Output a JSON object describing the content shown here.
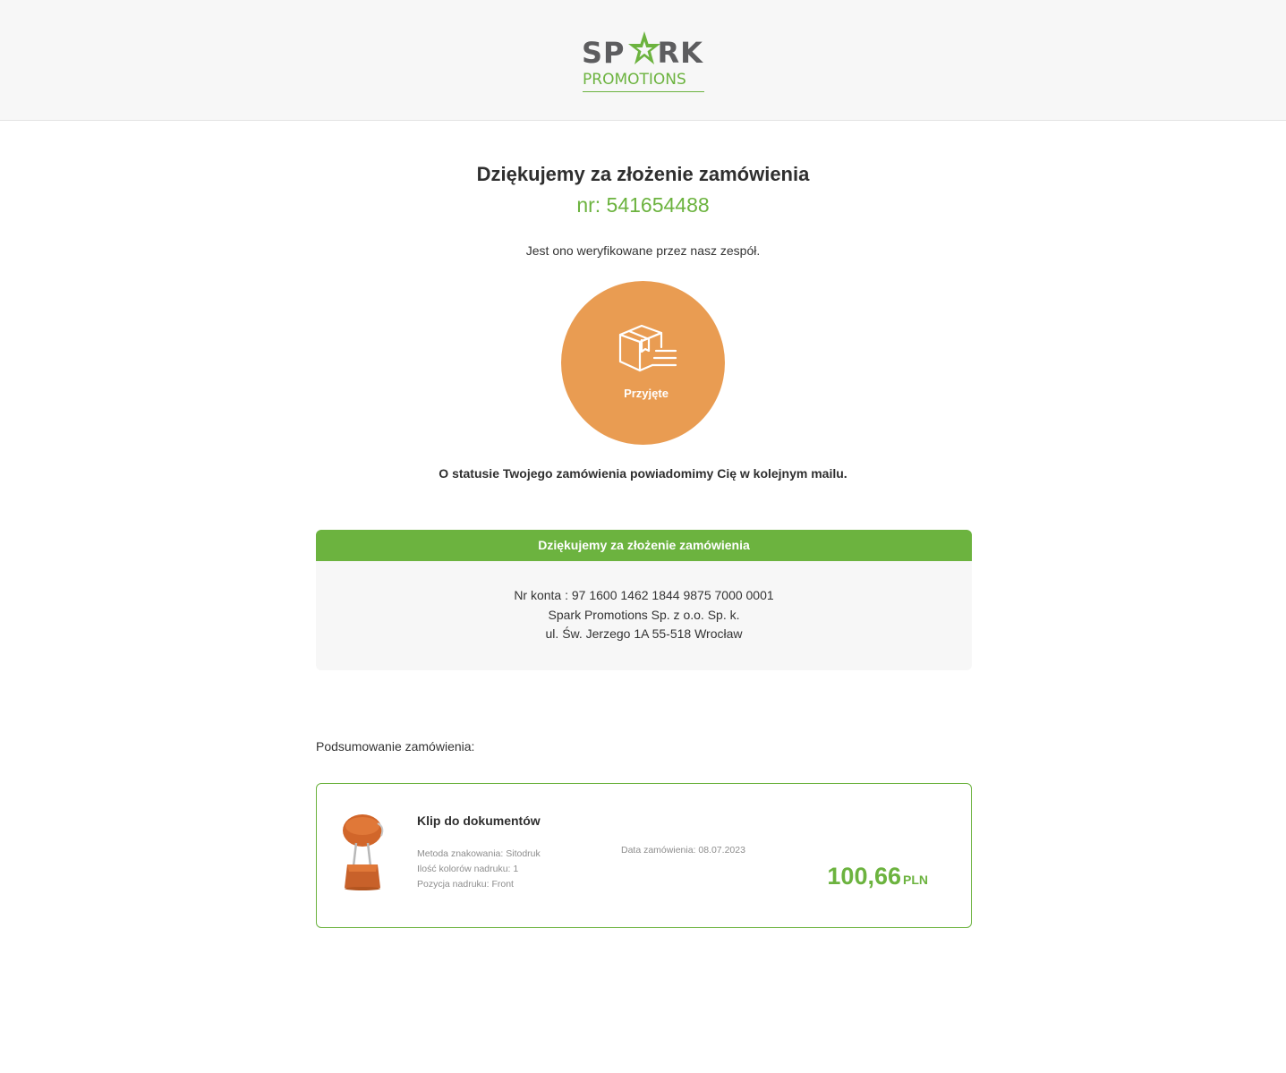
{
  "header": {
    "logo": {
      "top_left": "SP",
      "top_right": "RK",
      "bottom": "PROMOTIONS",
      "primary_color": "#5d5d5f",
      "accent_color": "#6cb33f"
    }
  },
  "confirmation": {
    "title": "Dziękujemy za złożenie zamówienia",
    "order_number": "nr: 541654488",
    "verification_text": "Jest ono weryfikowane przez nasz zespół.",
    "status": {
      "icon": "package-box-icon",
      "label": "Przyjęte",
      "color": "#e99c52"
    },
    "notify_text": "O statusie Twojego zamówienia powiadomimy Cię w kolejnym mailu."
  },
  "payment_info": {
    "header": "Dziękujemy za złożenie zamówienia",
    "account_line": "Nr konta : 97 1600 1462 1844 9875 7000 0001",
    "company_line": "Spark Promotions Sp. z o.o. Sp. k.",
    "address_line": "ul. Św. Jerzego 1A 55-518 Wrocław"
  },
  "summary": {
    "label": "Podsumowanie zamówienia:",
    "product": {
      "image_icon": "binder-clip-image",
      "name": "Klip do dokumentów",
      "details": [
        "Metoda znakowania: Sitodruk",
        "Ilość kolorów nadruku: 1",
        "Pozycja nadruku: Front"
      ],
      "order_date": "Data zamówienia: 08.07.2023",
      "price_amount": "100,66",
      "price_currency": "PLN"
    }
  }
}
